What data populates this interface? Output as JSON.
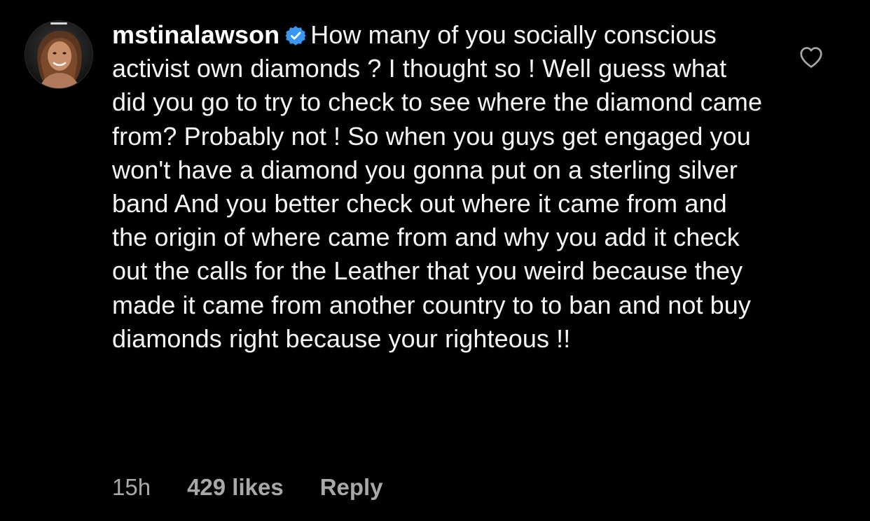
{
  "comment": {
    "username": "mstinalawson",
    "verified_icon": "verified-badge-icon",
    "text": "How many of you socially conscious activist  own diamonds ? I thought so ! Well guess what did you go to try to check to see where the diamond came from? Probably not ! So when you guys get engaged you won't have a diamond you gonna put on a sterling silver band And you better check out where it came from and the origin of where came from and why you add it check out the calls for the Leather that you weird because they made it came from another country to to ban and not buy diamonds right because your righteous !!",
    "time": "15h",
    "likes": "429 likes",
    "reply_label": "Reply",
    "like_icon": "heart-outline-icon"
  },
  "colors": {
    "background": "#000000",
    "text": "#ffffff",
    "meta_text": "#a8a8a8",
    "verified_blue": "#3897f0"
  }
}
